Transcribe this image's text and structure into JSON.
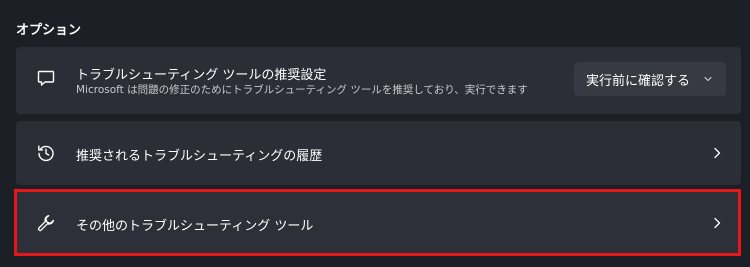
{
  "section": {
    "title": "オプション"
  },
  "rows": [
    {
      "title": "トラブルシューティング ツールの推奨設定",
      "description": "Microsoft は問題の修正のためにトラブルシューティング ツールを推奨しており、実行できます",
      "icon": "chat-bubble-icon",
      "dropdown_value": "実行前に確認する"
    },
    {
      "title": "推奨されるトラブルシューティングの履歴",
      "icon": "history-icon"
    },
    {
      "title": "その他のトラブルシューティング ツール",
      "icon": "wrench-icon"
    }
  ],
  "colors": {
    "background": "#1c1f26",
    "card": "#2b2e36",
    "highlight_border": "#e8161b"
  }
}
